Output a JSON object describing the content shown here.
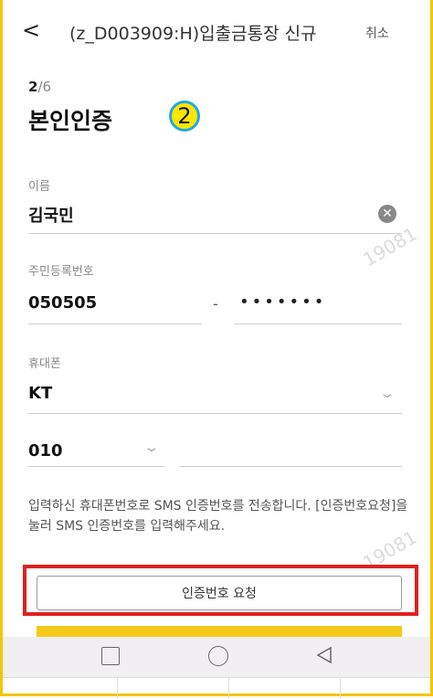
{
  "header": {
    "back_glyph": "<",
    "title": "(z_D003909:H)입출금통장 신규",
    "cancel_label": "취소"
  },
  "step": {
    "current": "2",
    "total": "/6"
  },
  "page_title": "본인인증",
  "step_badge": "2",
  "form": {
    "name": {
      "label": "이름",
      "value": "김국민"
    },
    "rrn": {
      "label": "주민등록번호",
      "front": "050505",
      "dash": "-",
      "back_masked": "•••••••"
    },
    "phone": {
      "label": "휴대폰",
      "carrier": "KT",
      "prefix": "010",
      "number": ""
    }
  },
  "notice": "입력하신 휴대폰번호로 SMS 인증번호를 전송합니다. [인증번호요청]을 눌러 SMS 인증번호를 입력해주세요.",
  "request_button_label": "인증번호 요청",
  "watermark": "19081",
  "colors": {
    "frame": "#f5c400",
    "highlight": "#e02020",
    "badge": "#ffe600",
    "badge_border": "#24a8e4",
    "confirm": "#f3c91a"
  }
}
